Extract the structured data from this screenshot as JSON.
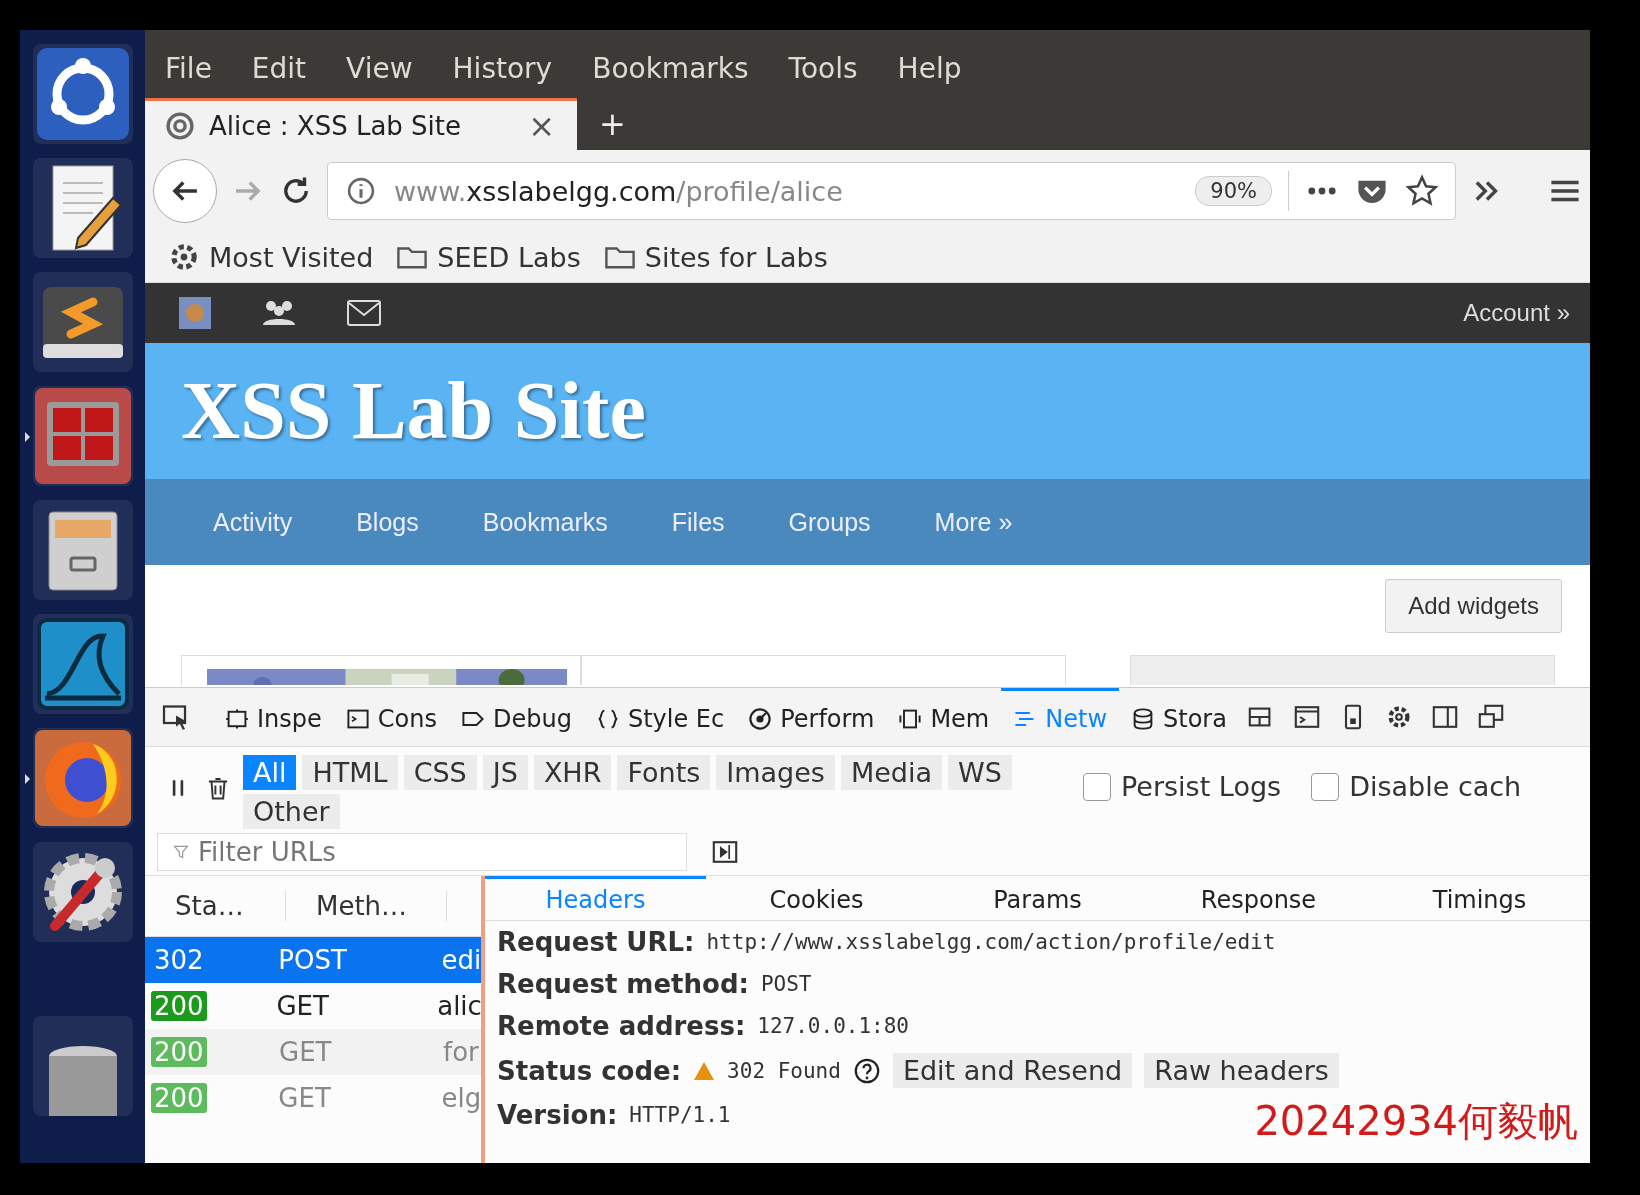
{
  "launcher": [
    {
      "kind": "ubuntu",
      "running": false
    },
    {
      "kind": "editor",
      "running": false
    },
    {
      "kind": "sublime",
      "running": false
    },
    {
      "kind": "terminal",
      "running": true
    },
    {
      "kind": "files",
      "running": false
    },
    {
      "kind": "wireshark",
      "running": false
    },
    {
      "kind": "firefox",
      "running": true
    },
    {
      "kind": "settings",
      "running": false
    },
    {
      "kind": "trash",
      "running": false
    }
  ],
  "menu": [
    "File",
    "Edit",
    "View",
    "History",
    "Bookmarks",
    "Tools",
    "Help"
  ],
  "tab": {
    "title": "Alice : XSS Lab Site",
    "close": "×",
    "new": "+"
  },
  "address": {
    "prefix": "www.",
    "domain": "xsslabelgg.com",
    "path": "/profile/alice",
    "zoom": "90%"
  },
  "bookmarks": [
    {
      "kind": "gear",
      "label": "Most Visited"
    },
    {
      "kind": "folder",
      "label": "SEED Labs"
    },
    {
      "kind": "folder",
      "label": "Sites for Labs"
    }
  ],
  "site": {
    "account": "Account »",
    "title": "XSS Lab Site",
    "nav": [
      "Activity",
      "Blogs",
      "Bookmarks",
      "Files",
      "Groups",
      "More »"
    ],
    "add_widgets": "Add widgets"
  },
  "devtools": {
    "tabs": [
      {
        "kind": "inspector",
        "label": "Inspe",
        "selected": false
      },
      {
        "kind": "console",
        "label": "Cons",
        "selected": false
      },
      {
        "kind": "debugger",
        "label": "Debug",
        "selected": false
      },
      {
        "kind": "style",
        "label": "Style Ec",
        "selected": false
      },
      {
        "kind": "performance",
        "label": "Perform",
        "selected": false
      },
      {
        "kind": "memory",
        "label": "Mem",
        "selected": false
      },
      {
        "kind": "network",
        "label": "Netw",
        "selected": true
      },
      {
        "kind": "storage",
        "label": "Stora",
        "selected": false
      }
    ],
    "filters": [
      {
        "label": "All",
        "selected": true
      },
      {
        "label": "HTML",
        "selected": false
      },
      {
        "label": "CSS",
        "selected": false
      },
      {
        "label": "JS",
        "selected": false
      },
      {
        "label": "XHR",
        "selected": false
      },
      {
        "label": "Fonts",
        "selected": false
      },
      {
        "label": "Images",
        "selected": false
      },
      {
        "label": "Media",
        "selected": false
      },
      {
        "label": "WS",
        "selected": false
      },
      {
        "label": "Other",
        "selected": false
      }
    ],
    "options": [
      {
        "label": "Persist Logs",
        "checked": false
      },
      {
        "label": "Disable cach",
        "checked": false
      }
    ],
    "filter_urls": {
      "placeholder": "Filter URLs"
    },
    "columns": [
      "Sta…",
      "Meth…"
    ],
    "requests": [
      {
        "status": "302",
        "method": "POST",
        "file": "edi",
        "selected": true,
        "muted": false
      },
      {
        "status": "200",
        "method": "GET",
        "file": "alic",
        "selected": false,
        "muted": false
      },
      {
        "status": "200",
        "method": "GET",
        "file": "for",
        "selected": false,
        "muted": true
      },
      {
        "status": "200",
        "method": "GET",
        "file": "elg",
        "selected": false,
        "muted": true
      }
    ],
    "detail_tabs": [
      {
        "label": "Headers",
        "selected": true
      },
      {
        "label": "Cookies",
        "selected": false
      },
      {
        "label": "Params",
        "selected": false
      },
      {
        "label": "Response",
        "selected": false
      },
      {
        "label": "Timings",
        "selected": false
      }
    ],
    "headers": [
      {
        "label": "Request URL:",
        "value": "http://www.xsslabelgg.com/action/profile/edit"
      },
      {
        "label": "Request method:",
        "value": "POST"
      },
      {
        "label": "Remote address:",
        "value": "127.0.0.1:80"
      }
    ],
    "status": {
      "label": "Status code:",
      "value": "302 Found",
      "buttons": [
        "Edit and Resend",
        "Raw headers"
      ]
    },
    "version": {
      "label": "Version:",
      "value": "HTTP/1.1"
    }
  },
  "annotation": "20242934何毅帆"
}
